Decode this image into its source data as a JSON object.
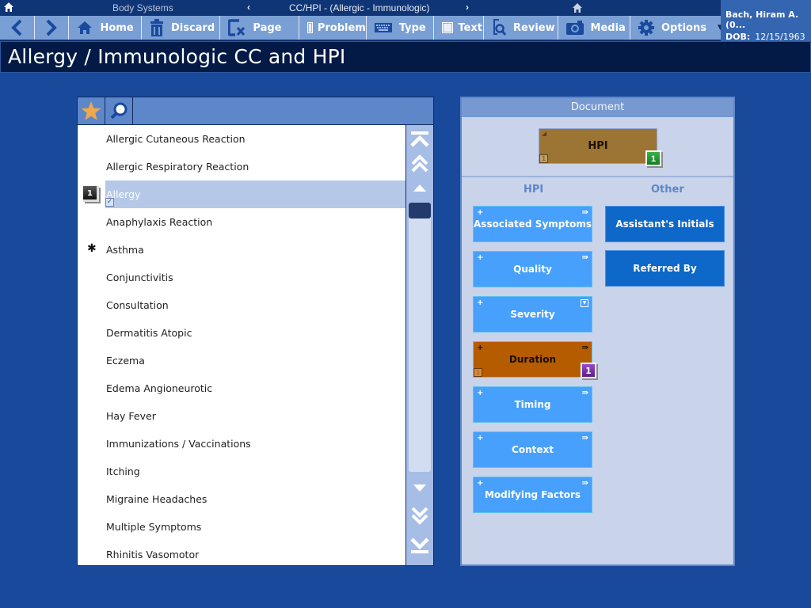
{
  "topbar": {
    "section": "Body Systems",
    "prev_symbol": "‹",
    "breadcrumb": "CC/HPI - (Allergic - Immunologic)",
    "next_symbol": "›"
  },
  "toolbar": {
    "home": "Home",
    "discard": "Discard",
    "page": "Page",
    "problem": "Problem",
    "type": "Type",
    "text": "Text",
    "review": "Review",
    "media": "Media",
    "options": "Options",
    "options_caret": "▼"
  },
  "patient": {
    "name": "Bach, Hiram A. (0...",
    "dob_label": "DOB:",
    "dob": "12/15/1963"
  },
  "page_title": "Allergy / Immunologic CC and HPI",
  "list": {
    "items": [
      {
        "label": "Allergic Cutaneous Reaction"
      },
      {
        "label": "Allergic Respiratory Reaction"
      },
      {
        "label": "Allergy",
        "selected": true,
        "count": "1",
        "check": "✓"
      },
      {
        "label": "Anaphylaxis Reaction"
      },
      {
        "label": "Asthma",
        "mark": "✱"
      },
      {
        "label": "Conjunctivitis"
      },
      {
        "label": "Consultation"
      },
      {
        "label": "Dermatitis Atopic"
      },
      {
        "label": "Eczema"
      },
      {
        "label": "Edema Angioneurotic"
      },
      {
        "label": "Hay Fever"
      },
      {
        "label": "Immunizations / Vaccinations"
      },
      {
        "label": "Itching"
      },
      {
        "label": "Migraine Headaches"
      },
      {
        "label": "Multiple Symptoms"
      },
      {
        "label": "Rhinitis Vasomotor"
      }
    ],
    "scroll_position": 0.0
  },
  "document": {
    "header": "Document",
    "hpi_doc": {
      "label": "HPI",
      "mini_count": "1",
      "badge": "1"
    },
    "hpi_column_title": "HPI",
    "other_column_title": "Other",
    "hpi_buttons": [
      {
        "label": "Associated Symptoms",
        "plus": "+",
        "arrow": "⇛"
      },
      {
        "label": "Quality",
        "plus": "+",
        "arrow": "⇛"
      },
      {
        "label": "Severity",
        "plus": "+",
        "dropdown": "▼"
      },
      {
        "label": "Duration",
        "plus": "+",
        "arrow": "⇛",
        "active": true,
        "mini_count": "1",
        "badge": "1"
      },
      {
        "label": "Timing",
        "plus": "+",
        "arrow": "⇛"
      },
      {
        "label": "Context",
        "plus": "+",
        "arrow": "⇛"
      },
      {
        "label": "Modifying Factors",
        "plus": "+",
        "arrow": "⇛"
      }
    ],
    "other_buttons": [
      {
        "label": "Assistant's Initials"
      },
      {
        "label": "Referred By"
      }
    ]
  },
  "colors": {
    "background": "#18499b",
    "toolbar": "#7a9fd4",
    "title_bar": "#021a45",
    "hpi_button": "#47a0fb",
    "hpi_active": "#b55c00",
    "other_button": "#0d68c9",
    "hpi_doc": "#9c7433"
  }
}
